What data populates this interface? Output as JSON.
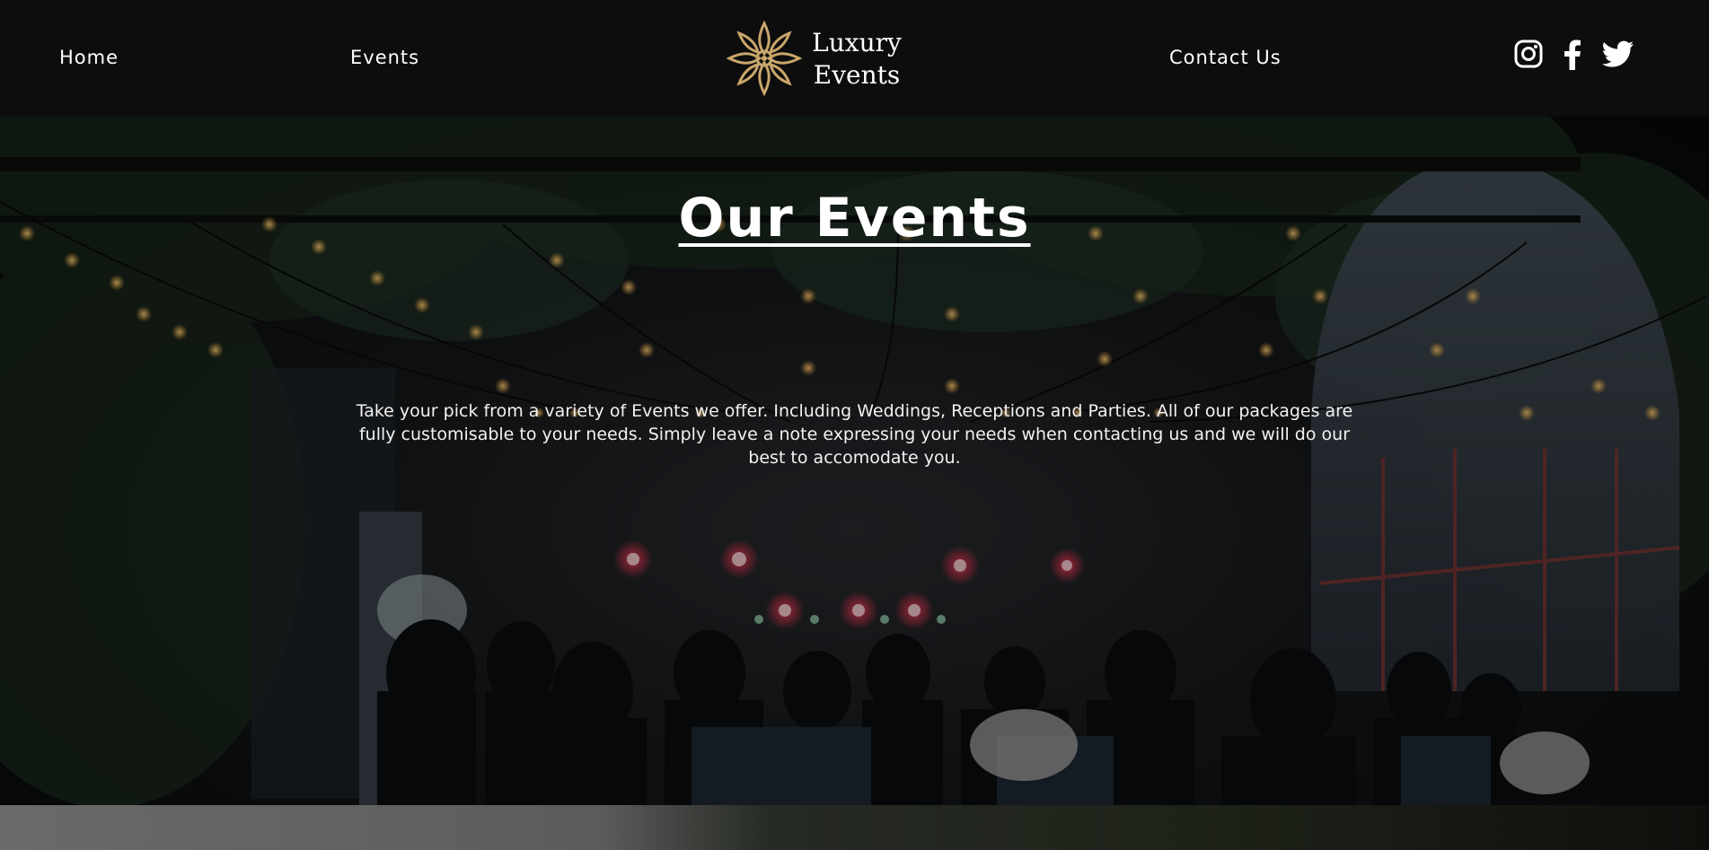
{
  "nav": {
    "home": "Home",
    "events": "Events",
    "contact": "Contact Us",
    "logo_line1": "Luxury",
    "logo_line2": "Events",
    "social": [
      "instagram-icon",
      "facebook-icon",
      "twitter-icon"
    ]
  },
  "hero": {
    "title": "Our Events",
    "description": "Take your pick from a variety of Events we offer. Including Weddings, Receptions and Parties. All of our packages are fully customisable to your needs. Simply leave a note expressing your needs when contacting us and we will do our best to accomodate you."
  },
  "colors": {
    "nav_bg": "#0d0d0d",
    "logo_gold": "#c9a66b",
    "text": "#ffffff"
  }
}
